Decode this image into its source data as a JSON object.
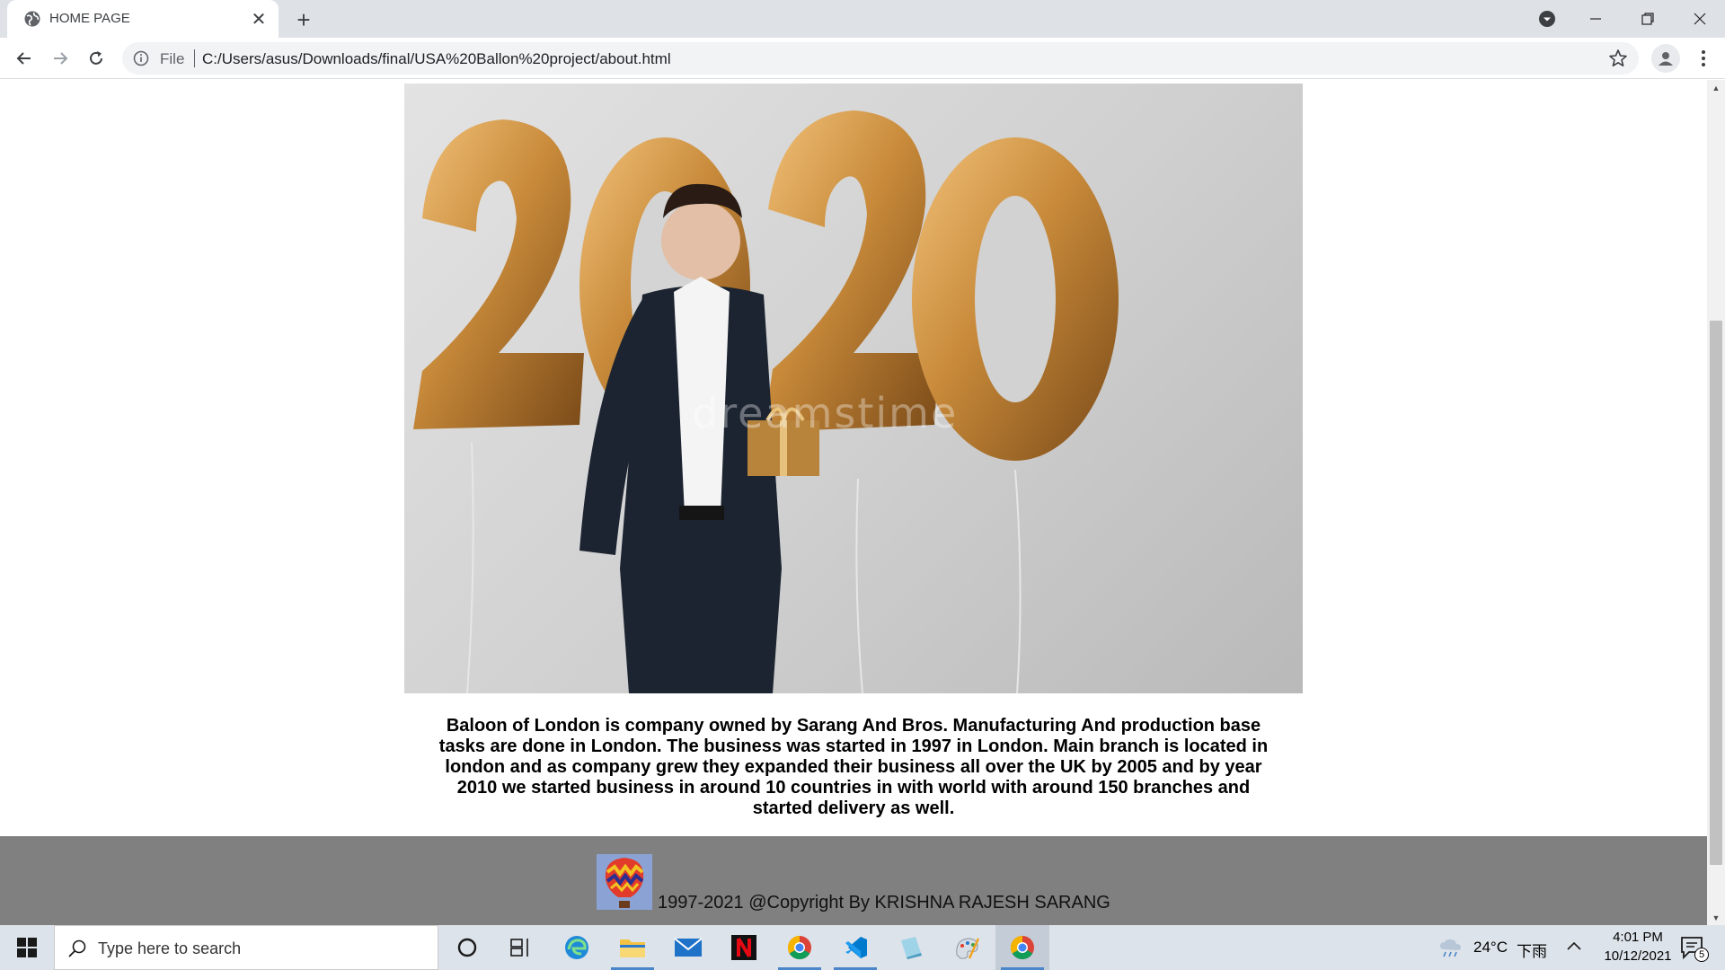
{
  "browser": {
    "tab": {
      "title": "HOME PAGE",
      "favicon_icon": "globe-icon",
      "close_label": "✕"
    },
    "new_tab_label": "+",
    "omnibox": {
      "scheme_label": "File",
      "url": "C:/Users/asus/Downloads/final/USA%20Ballon%20project/about.html"
    }
  },
  "page": {
    "hero_image": {
      "subject": "man-in-suit-with-2020-gold-balloons",
      "watermark": "dreamstime"
    },
    "about_text": "Baloon of London is company owned by Sarang And Bros. Manufacturing And production base tasks are done in London. The business was started in 1997 in London. Main branch is located in london and as company grew they expanded their business all over the UK by 2005 and by year 2010 we started business in around 10 countries in with world with around 150 branches and started delivery as well.",
    "footer": {
      "logo": "hot-air-balloon-logo",
      "copyright": "1997-2021 @Copyright By KRISHNA RAJESH SARANG"
    }
  },
  "taskbar": {
    "search_placeholder": "Type here to search",
    "weather": {
      "temperature": "24°C",
      "condition": "下雨"
    },
    "clock": {
      "time": "4:01 PM",
      "date": "10/12/2021"
    },
    "notification_count": "5"
  },
  "colors": {
    "footer_bg": "#808080",
    "tab_strip_bg": "#dee1e6",
    "taskbar_bg": "#dde3ea",
    "balloon_gold": "#c88a3a"
  }
}
